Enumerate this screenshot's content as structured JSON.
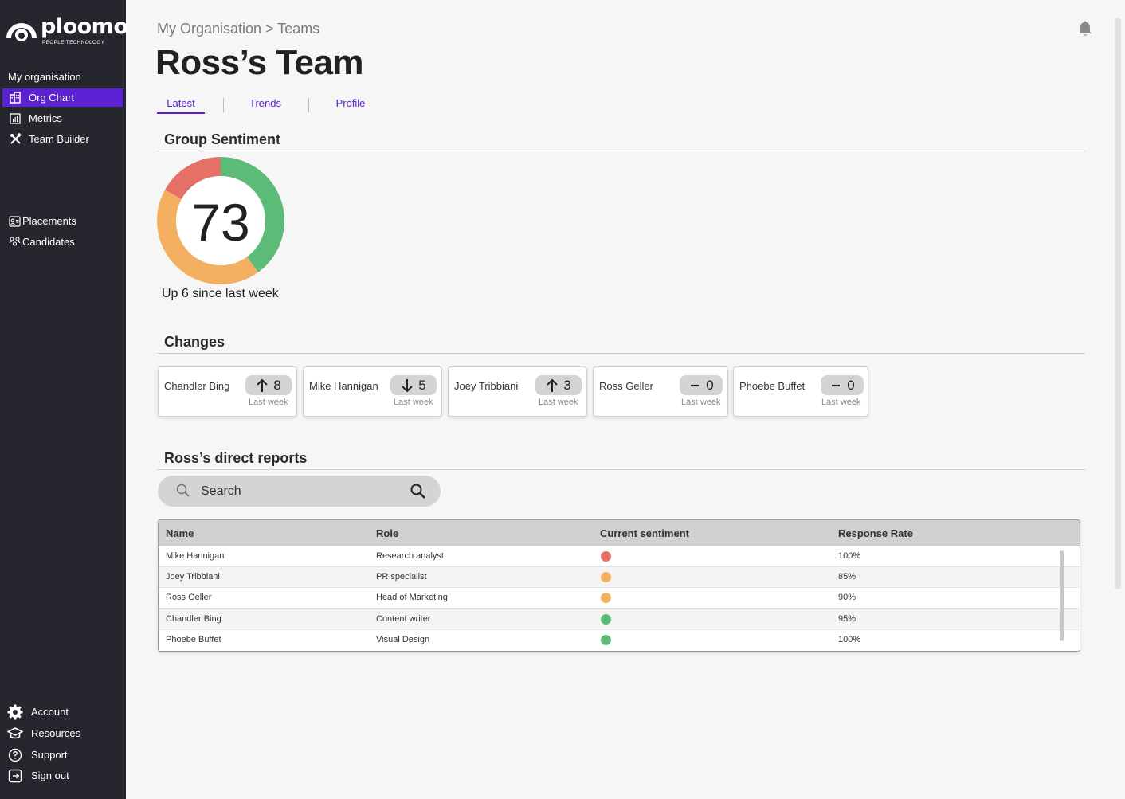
{
  "brand": {
    "name": "ploomo",
    "tagline": "PEOPLE TECHNOLOGY"
  },
  "sidebar": {
    "heading": "My organisation",
    "items": [
      {
        "label": "Org Chart",
        "icon": "org-chart-icon",
        "active": true
      },
      {
        "label": "Metrics",
        "icon": "metrics-icon",
        "active": false
      },
      {
        "label": "Team Builder",
        "icon": "team-builder-icon",
        "active": false
      }
    ],
    "secondary": [
      {
        "label": "Placements",
        "icon": "placements-icon"
      },
      {
        "label": "Candidates",
        "icon": "candidates-icon"
      }
    ],
    "bottom": [
      {
        "label": "Account",
        "icon": "gear-icon"
      },
      {
        "label": "Resources",
        "icon": "graduation-cap-icon"
      },
      {
        "label": "Support",
        "icon": "help-icon"
      },
      {
        "label": "Sign out",
        "icon": "sign-out-icon"
      }
    ]
  },
  "header": {
    "breadcrumb": "My Organisation > Teams",
    "title": "Ross’s Team"
  },
  "tabs": [
    {
      "label": "Latest",
      "active": true
    },
    {
      "label": "Trends",
      "active": false
    },
    {
      "label": "Profile",
      "active": false
    }
  ],
  "sentiment": {
    "title": "Group Sentiment",
    "score": "73",
    "caption": "Up 6 since last week",
    "segments": [
      {
        "color": "#5dbb78",
        "fraction": 0.4
      },
      {
        "color": "#f4b061",
        "fraction": 0.43
      },
      {
        "color": "#e57065",
        "fraction": 0.17
      }
    ]
  },
  "changes": {
    "title": "Changes",
    "items": [
      {
        "name": "Chandler Bing",
        "direction": "up",
        "value": "8",
        "sub": "Last week"
      },
      {
        "name": "Mike Hannigan",
        "direction": "down",
        "value": "5",
        "sub": "Last week"
      },
      {
        "name": "Joey Tribbiani",
        "direction": "up",
        "value": "3",
        "sub": "Last week"
      },
      {
        "name": "Ross Geller",
        "direction": "none",
        "value": "0",
        "sub": "Last week"
      },
      {
        "name": "Phoebe Buffet",
        "direction": "none",
        "value": "0",
        "sub": "Last week"
      }
    ]
  },
  "reports": {
    "title": "Ross’s direct reports",
    "search_placeholder": "Search",
    "columns": [
      "Name",
      "Role",
      "Current sentiment",
      "Response Rate"
    ],
    "rows": [
      {
        "name": "Mike Hannigan",
        "role": "Research analyst",
        "sentiment_color": "#e57065",
        "rate": "100%"
      },
      {
        "name": "Joey Tribbiani",
        "role": "PR specialist",
        "sentiment_color": "#f4b061",
        "rate": "85%"
      },
      {
        "name": "Ross Geller",
        "role": "Head of Marketing",
        "sentiment_color": "#f4b061",
        "rate": "90%"
      },
      {
        "name": "Chandler Bing",
        "role": "Content writer",
        "sentiment_color": "#5dbb78",
        "rate": "95%"
      },
      {
        "name": "Phoebe Buffet",
        "role": "Visual Design",
        "sentiment_color": "#5dbb78",
        "rate": "100%"
      }
    ]
  },
  "colors": {
    "accent": "#5b21d3",
    "sidebar_bg": "#25262e",
    "positive": "#5dbb78",
    "neutral": "#f4b061",
    "negative": "#e57065"
  }
}
